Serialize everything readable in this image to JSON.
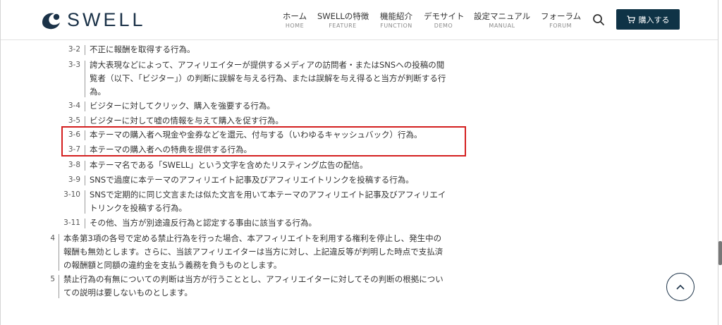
{
  "brand": {
    "name": "SWELL",
    "color": "#0f3346"
  },
  "nav": [
    {
      "label": "ホーム",
      "sub": "HOME"
    },
    {
      "label": "SWELLの特徴",
      "sub": "FEATURE"
    },
    {
      "label": "機能紹介",
      "sub": "FUNCTION"
    },
    {
      "label": "デモサイト",
      "sub": "DEMO"
    },
    {
      "label": "設定マニュアル",
      "sub": "MANUAL"
    },
    {
      "label": "フォーラム",
      "sub": "FORUM"
    }
  ],
  "search": {
    "icon": "search-icon"
  },
  "buy_button": {
    "label": "購入する",
    "icon": "cart-icon"
  },
  "sub_items": [
    {
      "num": "3-2",
      "lines": [
        "不正に報酬を取得する行為。"
      ]
    },
    {
      "num": "3-3",
      "lines": [
        "誇大表現などによって、アフィリエイターが提供するメディアの訪問者・またはSNSへの投稿の閲",
        "覧者（以下、「ビジター」）の判断に誤解を与える行為、または誤解を与え得ると当方が判断する行",
        "為。"
      ]
    },
    {
      "num": "3-4",
      "lines": [
        "ビジターに対してクリック、購入を強要する行為。"
      ]
    },
    {
      "num": "3-5",
      "lines": [
        "ビジターに対して嘘の情報を与えて購入を促す行為。"
      ]
    },
    {
      "num": "3-6",
      "lines": [
        "本テーマの購入者へ現金や金券などを還元、付与する（いわゆるキャッシュバック）行為。"
      ]
    },
    {
      "num": "3-7",
      "lines": [
        "本テーマの購入者への特典を提供する行為。"
      ]
    },
    {
      "num": "3-8",
      "lines": [
        "本テーマ名である「SWELL」という文字を含めたリスティング広告の配信。"
      ]
    },
    {
      "num": "3-9",
      "lines": [
        "SNSで過度に本テーマのアフィリエイト記事及びアフィリエイトリンクを投稿する行為。"
      ]
    },
    {
      "num": "3-10",
      "lines": [
        "SNSで定期的に同じ文言または似た文言を用いて本テーマのアフィリエイト記事及びアフィリエイ",
        "トリンクを投稿する行為。"
      ]
    },
    {
      "num": "3-11",
      "lines": [
        "その他、当方が別途違反行為と認定する事由に該当する行為。"
      ]
    }
  ],
  "main_items": [
    {
      "num": "4",
      "lines": [
        "本条第3項の各号で定める禁止行為を行った場合、本アフィリエイトを利用する権利を停止し、発生中の",
        "報酬も無効とします。さらに、当該アフィリエイターは当方に対し、上記違反等が判明した時点で支払済",
        "の報酬額と同額の違約金を支払う義務を負うものとします。"
      ]
    },
    {
      "num": "5",
      "lines": [
        "禁止行為の有無についての判断は当方が行うこととし、アフィリエイターに対してその判断の根拠につい",
        "ての説明は要しないものとします。"
      ]
    }
  ],
  "highlight_color": "#d41f1f"
}
